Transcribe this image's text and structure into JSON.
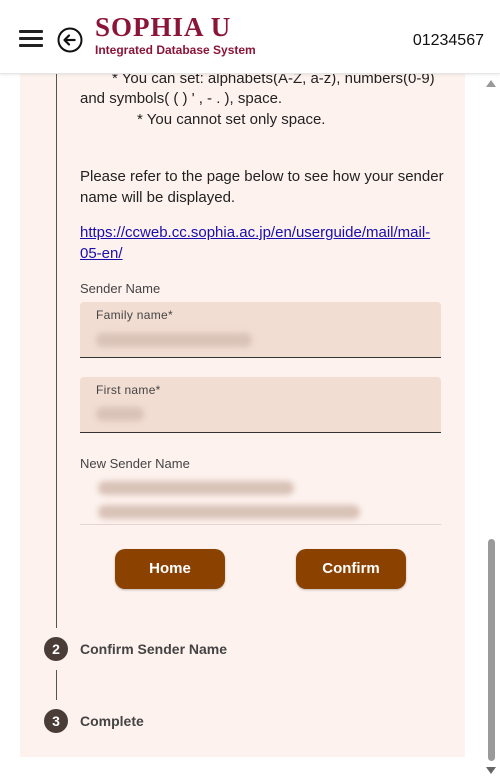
{
  "header": {
    "logo_main": "SOPHIA U",
    "logo_sub": "Integrated Database System",
    "user_id": "01234567"
  },
  "instructions": {
    "allowed_chars": "* You can set:  alphabets(A-Z, a-z), numbers(0-9)",
    "allowed_chars_cont": "and symbols( ( ) ' , - . ), space.",
    "no_space_only": "* You cannot set only space.",
    "refer_line1": "Please refer to the page below to see how your sender",
    "refer_line2": "name will be displayed.",
    "link_line1": "https://ccweb.cc.sophia.ac.jp/en/userguide/mail/mail-",
    "link_line2": "05-en/"
  },
  "form": {
    "sender_name_label": "Sender Name",
    "family_name_label": "Family name*",
    "first_name_label": "First name*",
    "new_sender_name_label": "New Sender Name"
  },
  "buttons": {
    "home": "Home",
    "confirm": "Confirm"
  },
  "steps": [
    {
      "number": "2",
      "title": "Confirm Sender Name"
    },
    {
      "number": "3",
      "title": "Complete"
    }
  ],
  "colors": {
    "brand": "#8a1538",
    "button": "#8b4200",
    "panel_bg": "#fdf2ee",
    "field_bg": "#f2ddd3"
  }
}
